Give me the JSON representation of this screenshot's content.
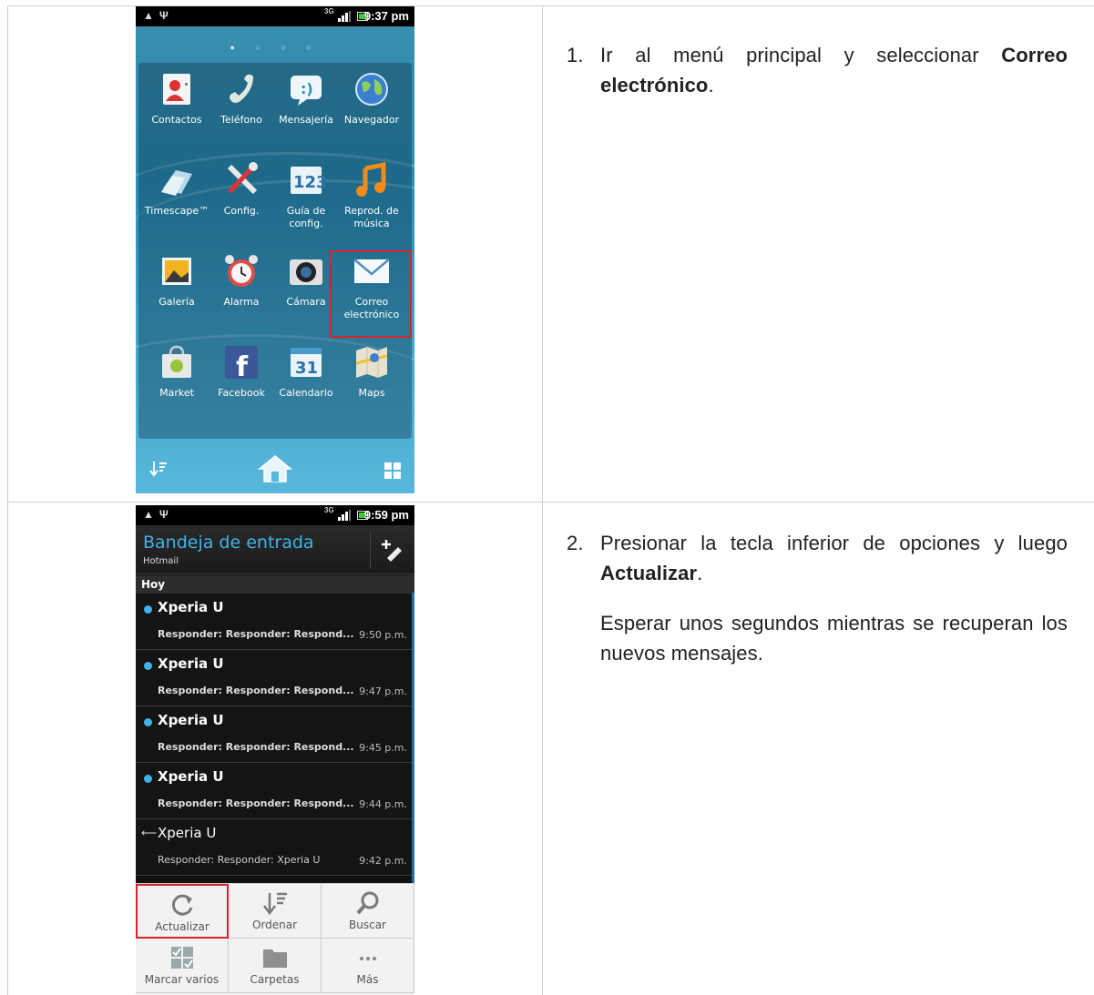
{
  "steps": [
    {
      "number": "1.",
      "text_before": "Ir al menú principal y seleccionar ",
      "bold": "Correo electrónico",
      "text_after": "."
    },
    {
      "number": "2.",
      "text_before": "Presionar la tecla inferior de opciones y luego ",
      "bold": "Actualizar",
      "text_after": ".",
      "paragraph2": "Esperar unos segundos mientras se recuperan los nuevos mensajes."
    }
  ],
  "phone1": {
    "status_time": "9:37 pm",
    "network": "3G",
    "apps": [
      {
        "label": "Contactos",
        "icon": "contacts-icon"
      },
      {
        "label": "Teléfono",
        "icon": "phone-icon"
      },
      {
        "label": "Mensajería",
        "icon": "messaging-icon"
      },
      {
        "label": "Navegador",
        "icon": "browser-globe-icon"
      },
      {
        "label": "Timescape™",
        "icon": "timescape-icon"
      },
      {
        "label": "Config.",
        "icon": "settings-tools-icon"
      },
      {
        "label": "Guía de config.",
        "icon": "setup-guide-icon",
        "icon_text": "123"
      },
      {
        "label": "Reprod. de música",
        "icon": "music-note-icon"
      },
      {
        "label": "Galería",
        "icon": "gallery-icon"
      },
      {
        "label": "Alarma",
        "icon": "alarm-clock-icon"
      },
      {
        "label": "Cámara",
        "icon": "camera-icon"
      },
      {
        "label": "Correo electrónico",
        "icon": "mail-envelope-icon"
      },
      {
        "label": "Market",
        "icon": "market-bag-icon"
      },
      {
        "label": "Facebook",
        "icon": "facebook-icon",
        "icon_text": "f"
      },
      {
        "label": "Calendario",
        "icon": "calendar-icon",
        "icon_text": "31"
      },
      {
        "label": "Maps",
        "icon": "maps-icon"
      }
    ]
  },
  "phone2": {
    "status_time": "9:59 pm",
    "network": "3G",
    "title": "Bandeja de entrada",
    "account": "Hotmail",
    "section": "Hoy",
    "messages": [
      {
        "sender": "Xperia U",
        "subject": "Responder: Responder: Respond...",
        "time": "9:50 p.m.",
        "unread": true
      },
      {
        "sender": "Xperia U",
        "subject": "Responder: Responder: Respond...",
        "time": "9:47 p.m.",
        "unread": true
      },
      {
        "sender": "Xperia U",
        "subject": "Responder: Responder: Respond...",
        "time": "9:45 p.m.",
        "unread": true
      },
      {
        "sender": "Xperia U",
        "subject": "Responder: Responder: Respond...",
        "time": "9:44 p.m.",
        "unread": true
      },
      {
        "sender": "Xperia U",
        "subject": "Responder: Responder: Xperia U",
        "time": "9:42 p.m.",
        "unread": false
      }
    ],
    "menu": [
      {
        "label": "Actualizar",
        "icon": "refresh-icon"
      },
      {
        "label": "Ordenar",
        "icon": "sort-icon"
      },
      {
        "label": "Buscar",
        "icon": "search-icon"
      },
      {
        "label": "Marcar varios",
        "icon": "mark-multiple-icon"
      },
      {
        "label": "Carpetas",
        "icon": "folder-icon"
      },
      {
        "label": "Más",
        "icon": "more-icon",
        "icon_text": "..."
      }
    ]
  },
  "colors": {
    "highlight": "#d9232a",
    "accent": "#3fb3ea"
  }
}
